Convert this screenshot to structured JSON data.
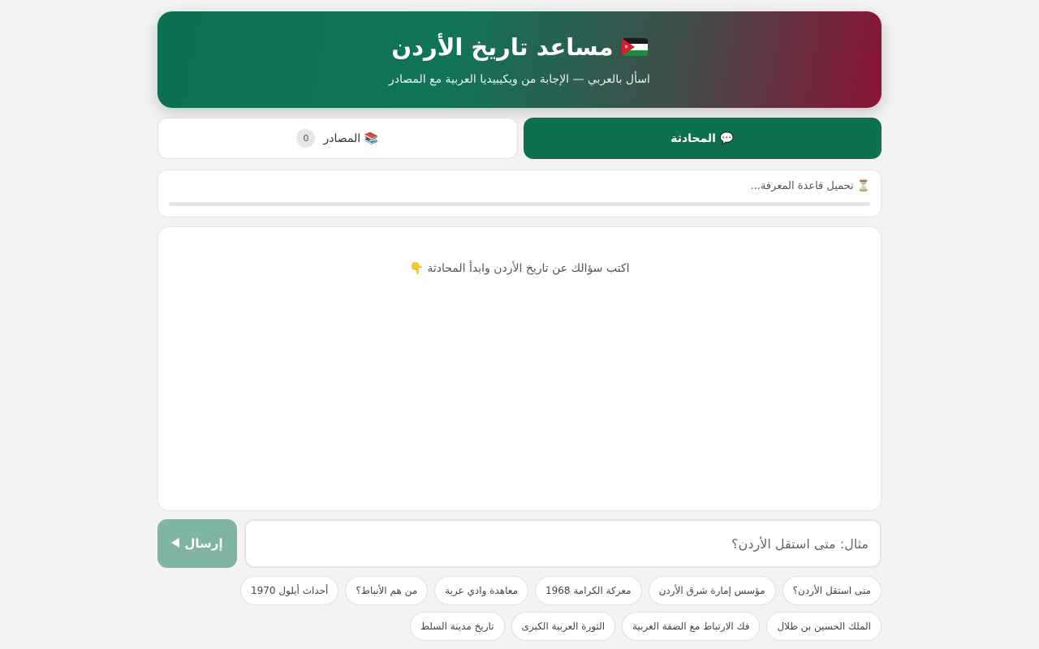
{
  "header": {
    "title": "مساعد تاريخ الأردن",
    "subtitle": "اسأل بالعربي — الإجابة من ويكيبيديا العربية مع المصادر",
    "flag_icon": "jordan-flag-icon"
  },
  "tabs": [
    {
      "label": "💬 المحادثة",
      "active": true
    },
    {
      "label": "📚 المصادر",
      "count": "0",
      "active": false
    }
  ],
  "loading": {
    "text": "⏳ تحميل قاعدة المعرفة...",
    "progress": 0
  },
  "chat": {
    "empty_message": "اكتب سؤالك عن تاريخ الأردن وابدأ المحادثة 👇"
  },
  "input": {
    "placeholder": "مثال: متى استقل الأردن؟",
    "value": ""
  },
  "send_button": {
    "label": "إرسال",
    "icon": "play-arrow-icon"
  },
  "suggestions": [
    "متى استقل الأردن؟",
    "مؤسس إمارة شرق الأردن",
    "معركة الكرامة 1968",
    "معاهدة وادي عربة",
    "من هم الأنباط؟",
    "أحداث أيلول 1970",
    "الملك الحسين بن طلال",
    "فك الارتباط مع الضفة الغربية",
    "الثورة العربية الكبرى",
    "تاريخ مدينة السلط"
  ],
  "colors": {
    "primary": "#0c7051",
    "accent_red": "#8c1436",
    "send_disabled": "#7fb5a2",
    "background": "#f2f3f2"
  }
}
